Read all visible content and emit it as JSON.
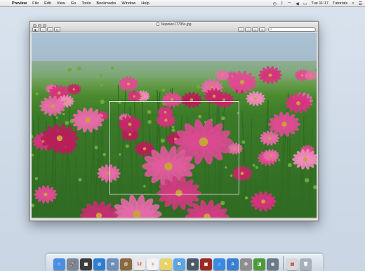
{
  "menubar": {
    "apple_glyph": "",
    "items": [
      "Preview",
      "File",
      "Edit",
      "View",
      "Go",
      "Tools",
      "Bookmarks",
      "Window",
      "Help"
    ],
    "status": {
      "clock": "Tue 11:17",
      "user": "Tutorials"
    }
  },
  "window": {
    "title": "Napoleo17795s.jpg",
    "toolbar_left": [
      "◧",
      "−",
      "+",
      "↻"
    ],
    "toolbar_right": [
      "‹",
      "›",
      "□",
      "≡"
    ],
    "search_placeholder": ""
  },
  "dock": {
    "apps": [
      {
        "name": "finder",
        "glyph": "☺",
        "color": "#4a8fe0"
      },
      {
        "name": "launchpad",
        "glyph": "🚀",
        "color": "#7b8797"
      },
      {
        "name": "mission-control",
        "glyph": "▦",
        "color": "#3c3c3c"
      },
      {
        "name": "safari",
        "glyph": "◎",
        "color": "#2e7fd4"
      },
      {
        "name": "mail",
        "glyph": "✉",
        "color": "#6d8fb8"
      },
      {
        "name": "contacts",
        "glyph": "@",
        "color": "#8a6a3c"
      },
      {
        "name": "calendar",
        "glyph": "12",
        "color": "#e8e8e8"
      },
      {
        "name": "reminders",
        "glyph": "≡",
        "color": "#f2f2f2"
      },
      {
        "name": "notes",
        "glyph": "✎",
        "color": "#e8d26a"
      },
      {
        "name": "messages",
        "glyph": "💬",
        "color": "#5aa7e8"
      },
      {
        "name": "facetime",
        "glyph": "◉",
        "color": "#4a5a6a"
      },
      {
        "name": "photo-booth",
        "glyph": "▣",
        "color": "#9b2a22"
      },
      {
        "name": "itunes",
        "glyph": "♫",
        "color": "#3a8ae0"
      },
      {
        "name": "app-store",
        "glyph": "A",
        "color": "#3b7fd1"
      },
      {
        "name": "system-preferences",
        "glyph": "⚙",
        "color": "#8e8e8e"
      },
      {
        "name": "preview",
        "glyph": "◨",
        "color": "#4d9a3a"
      },
      {
        "name": "network-utility",
        "glyph": "◍",
        "color": "#6a7a8a"
      }
    ],
    "trailing": [
      {
        "name": "documents",
        "glyph": "▤",
        "color": "#d8d8d8"
      },
      {
        "name": "trash",
        "glyph": "🗑",
        "color": "#a8b0ba"
      }
    ]
  }
}
